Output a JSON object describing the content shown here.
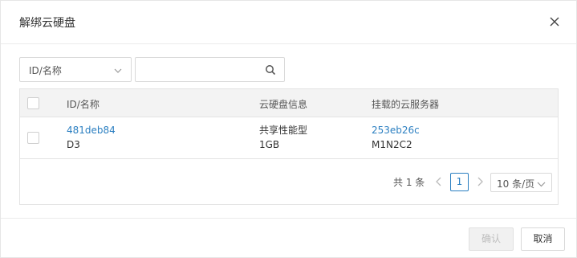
{
  "dialog": {
    "title": "解绑云硬盘"
  },
  "filter": {
    "selected": "ID/名称"
  },
  "search": {
    "value": "",
    "placeholder": ""
  },
  "table": {
    "columns": [
      "ID/名称",
      "云硬盘信息",
      "挂载的云服务器"
    ],
    "rows": [
      {
        "disk_id": "481deb84",
        "disk_name": "D3",
        "disk_type": "共享性能型",
        "disk_size": "1GB",
        "server_id": "253eb26c",
        "server_name": "M1N2C2"
      }
    ]
  },
  "pagination": {
    "total_text": "共 1 条",
    "current_page": "1",
    "page_size": "10 条/页"
  },
  "footer": {
    "confirm_label": "确认",
    "cancel_label": "取消"
  },
  "colors": {
    "link": "#2b7fc1",
    "header_bg": "#f3f3f3",
    "disabled_text": "#bdbdbd"
  }
}
